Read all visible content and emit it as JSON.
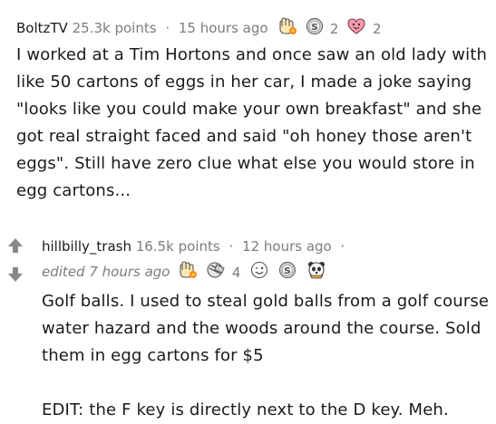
{
  "comments": [
    {
      "username": "BoltzTV",
      "points": "25.3k points",
      "separator": "·",
      "time": "15 hours ago",
      "awards": [
        {
          "icon": "helpful-hand-award-icon",
          "count": ""
        },
        {
          "icon": "silver-coin-award-icon",
          "count": "2"
        },
        {
          "icon": "wholesome-heart-award-icon",
          "count": "2"
        }
      ],
      "paragraphs": [
        "I worked at a Tim Hortons and once saw an old lady with like 50 cartons of eggs in her car, I made a joke saying \"looks like you could make your own breakfast\" and she got real straight faced and said \"oh honey those aren't eggs\". Still have zero clue what else you would store in egg cartons..."
      ]
    },
    {
      "username": "hillbilly_trash",
      "points": "16.5k points",
      "separator": "·",
      "time": "12 hours ago",
      "trailing_separator": "·",
      "edited": "edited 7 hours ago",
      "awards": [
        {
          "icon": "helpful-hand-award-icon",
          "count": ""
        },
        {
          "icon": "facepalm-award-icon",
          "count": "4"
        },
        {
          "icon": "wink-face-award-icon",
          "count": ""
        },
        {
          "icon": "silver-coin-award-icon",
          "count": ""
        },
        {
          "icon": "panda-award-icon",
          "count": ""
        }
      ],
      "paragraphs": [
        "Golf balls. I used to steal gold balls from a golf course water hazard and the woods around the course. Sold them in egg cartons for $5",
        "EDIT: the F key is directly next to the D key. Meh."
      ]
    }
  ],
  "colors": {
    "meta_text": "#7c7c7c",
    "body_text": "#1a1a1b",
    "vote_arrow": "#878a8c"
  }
}
